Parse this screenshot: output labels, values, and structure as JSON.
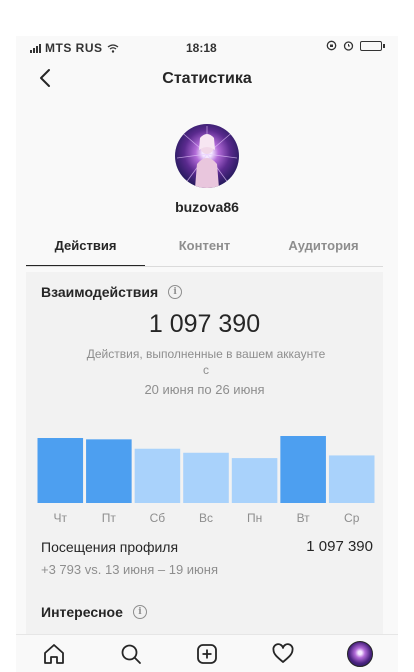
{
  "status_bar": {
    "carrier": "MTS RUS",
    "time": "18:18"
  },
  "header": {
    "title": "Статистика"
  },
  "profile": {
    "username": "buzova86"
  },
  "tabs": [
    {
      "label": "Действия",
      "active": true
    },
    {
      "label": "Контент",
      "active": false
    },
    {
      "label": "Аудитория",
      "active": false
    }
  ],
  "interactions": {
    "title": "Взаимодействия",
    "total": "1 097 390",
    "description": "Действия, выполненные в вашем аккаунте с",
    "date_range": "20 июня по 26 июня"
  },
  "chart_data": {
    "type": "bar",
    "categories": [
      "Чт",
      "Пт",
      "Сб",
      "Вс",
      "Пн",
      "Вт",
      "Ср"
    ],
    "values": [
      0.97,
      0.95,
      0.81,
      0.75,
      0.67,
      1.0,
      0.71
    ],
    "highlighted": [
      true,
      true,
      false,
      false,
      false,
      true,
      false
    ],
    "colors": {
      "highlight": "#4d9ff0",
      "normal": "#a9d2fb"
    }
  },
  "profile_visits": {
    "label": "Посещения профиля",
    "value": "1 097 390",
    "comparison": "+3 793 vs. 13 июня – 19 июня"
  },
  "interesting": {
    "title": "Интересное"
  },
  "bottom_nav": [
    "home-icon",
    "search-icon",
    "add-post-icon",
    "heart-icon",
    "profile-avatar"
  ]
}
